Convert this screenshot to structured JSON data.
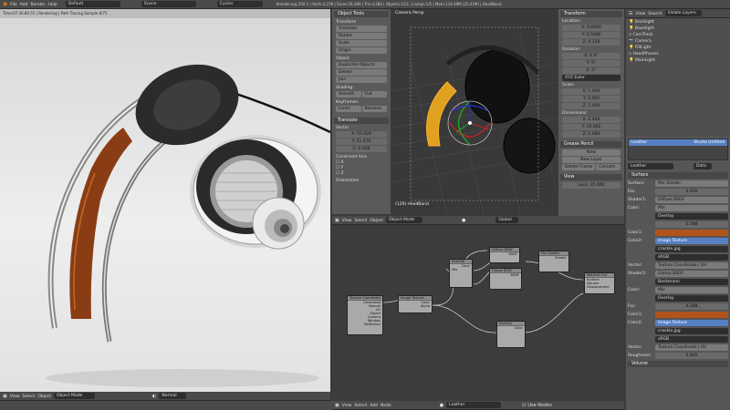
{
  "topbar": {
    "menus": [
      "File",
      "Add",
      "Render",
      "Help"
    ],
    "layout": "Default",
    "scene": "Scene",
    "engine": "Cycles",
    "stats": "blender.org 259.1 | Verts:2,239 | Faces:29,280 | Tris:4,280 | Objects:1/21 | Lamps:1/5 | Mem:119.49M (25.41M) | HeadBand"
  },
  "render_view": {
    "status": "Time:07:26.80.55 | Rendering | Path Tracing Sample 8/75",
    "menus": [
      "View",
      "Select",
      "Object"
    ],
    "mode": "Object Mode",
    "shading": "Normal"
  },
  "tools": {
    "header": "Object Tools",
    "transform_title": "Transform",
    "transform_buttons": [
      "Translate",
      "Rotate",
      "Scale",
      "Origin"
    ],
    "object_title": "Object",
    "object_buttons": [
      "Duplicate Objects",
      "Delete",
      "Join"
    ],
    "shading_title": "Shading:",
    "smooth": "Smooth",
    "flat": "Flat",
    "keyframes_title": "Keyframes:",
    "insert": "Insert",
    "remove": "Remove",
    "translate_header": "Translate",
    "vector_label": "Vector",
    "vector": [
      "X: 55.029",
      "Y: 31.470",
      "Z: 0.000"
    ],
    "constraint_label": "Constraint Axis",
    "axes": [
      "X",
      "Y",
      "Z"
    ],
    "orientation_label": "Orientation"
  },
  "viewport": {
    "label": "Camera Persp",
    "object_label": "(129) HeadBand",
    "menus": [
      "View",
      "Select",
      "Object"
    ],
    "mode": "Object Mode",
    "pivot": "Global"
  },
  "properties_n": {
    "transform_header": "Transform",
    "location_label": "Location:",
    "location": [
      "X: 0.0000",
      "Y: 0.5000",
      "Z: 4.120"
    ],
    "rotation_label": "Rotation:",
    "rotation": [
      "X: 6.9°",
      "Y: 9°",
      "Z: 0°"
    ],
    "rotation_mode": "XYZ Euler",
    "scale_label": "Scale:",
    "scale": [
      "X: 1.000",
      "Y: 1.000",
      "Z: 1.000"
    ],
    "dimensions_label": "Dimensions:",
    "dimensions": [
      "X: 2.462",
      "Y: 10.062",
      "Z: 2.084"
    ],
    "grease_header": "Grease Pencil",
    "new": "New",
    "new_layer": "New Layer",
    "delete_frame": "Delete Frame",
    "convert": "Convert",
    "view_header": "View",
    "lens": "Lens: 35.000"
  },
  "outliner": {
    "menus": [
      "View",
      "Search"
    ],
    "filter": "Visible Layers",
    "items": [
      "Backlight",
      "Baselight",
      "CamTrack",
      "Camera",
      "FillLight",
      "HeadPhones",
      "MainLight"
    ]
  },
  "materials": {
    "slots": [
      "Leather",
      "Studio Untitled"
    ],
    "material_name": "Leather",
    "mode": "Data"
  },
  "surface": {
    "header": "Surface",
    "surface_label": "Surface:",
    "surface_value": "Mix Shader",
    "fac_label": "Fac:",
    "fac_value": "0.400",
    "shader1_label": "Shader1:",
    "shader1_value": "Diffuse BSDF",
    "color_label": "Color:",
    "color_value": "Mix",
    "blend": "Overlay",
    "fac2": "0.288",
    "color1_label": "Color1:",
    "color2_label": "Color2:",
    "image_texture": "Image Texture",
    "image_file": "crackle.jpg",
    "srgb": "sRGB",
    "vector_label": "Vector:",
    "tex_coord": "Texture Coordinate | UV",
    "shader2_label": "Shader2:",
    "shader2_value": "Glossy BSDF",
    "distribution": "Beckmann",
    "color3_label": "Color:",
    "mix2": "Mix",
    "overlay2": "Overlay",
    "fac3_label": "Fac:",
    "fac3": "0.288",
    "color1b_label": "Color1:",
    "color2b_label": "Color2:",
    "image_texture2": "Image Texture",
    "image_file2": "crackle.jpg",
    "srgb2": "sRGB",
    "vector2_label": "Vector:",
    "tex_coord2": "Texture Coordinate | UV",
    "roughness_label": "Roughness:",
    "roughness": "0.800",
    "volume": "Volume",
    "leather_color": "#b0541c"
  },
  "node_editor": {
    "nodes": {
      "texcoord": {
        "title": "Texture Coordinate",
        "rows": [
          "Generated",
          "Normal",
          "UV",
          "Object",
          "Camera",
          "Window",
          "Reflection"
        ]
      },
      "imgtex": {
        "title": "Image Texture",
        "rows": [
          "Color",
          "Alpha"
        ]
      },
      "mixrgb": {
        "title": "MixRGB",
        "rows": [
          "Color",
          "Mix"
        ]
      },
      "diffuse": {
        "title": "Diffuse BSDF",
        "rows": [
          "BSDF"
        ]
      },
      "glossy": {
        "title": "Glossy BSDF",
        "rows": [
          "BSDF"
        ]
      },
      "mixshader": {
        "title": "Mix Shader",
        "rows": [
          "Shader"
        ]
      },
      "output": {
        "title": "Material Out",
        "rows": [
          "Surface",
          "Volume",
          "Displacement"
        ]
      },
      "multiply": {
        "title": "Multiply",
        "rows": [
          "Color"
        ]
      }
    },
    "menus": [
      "View",
      "Select",
      "Add",
      "Node"
    ],
    "material": "Leather",
    "use_nodes": "Use Nodes"
  }
}
